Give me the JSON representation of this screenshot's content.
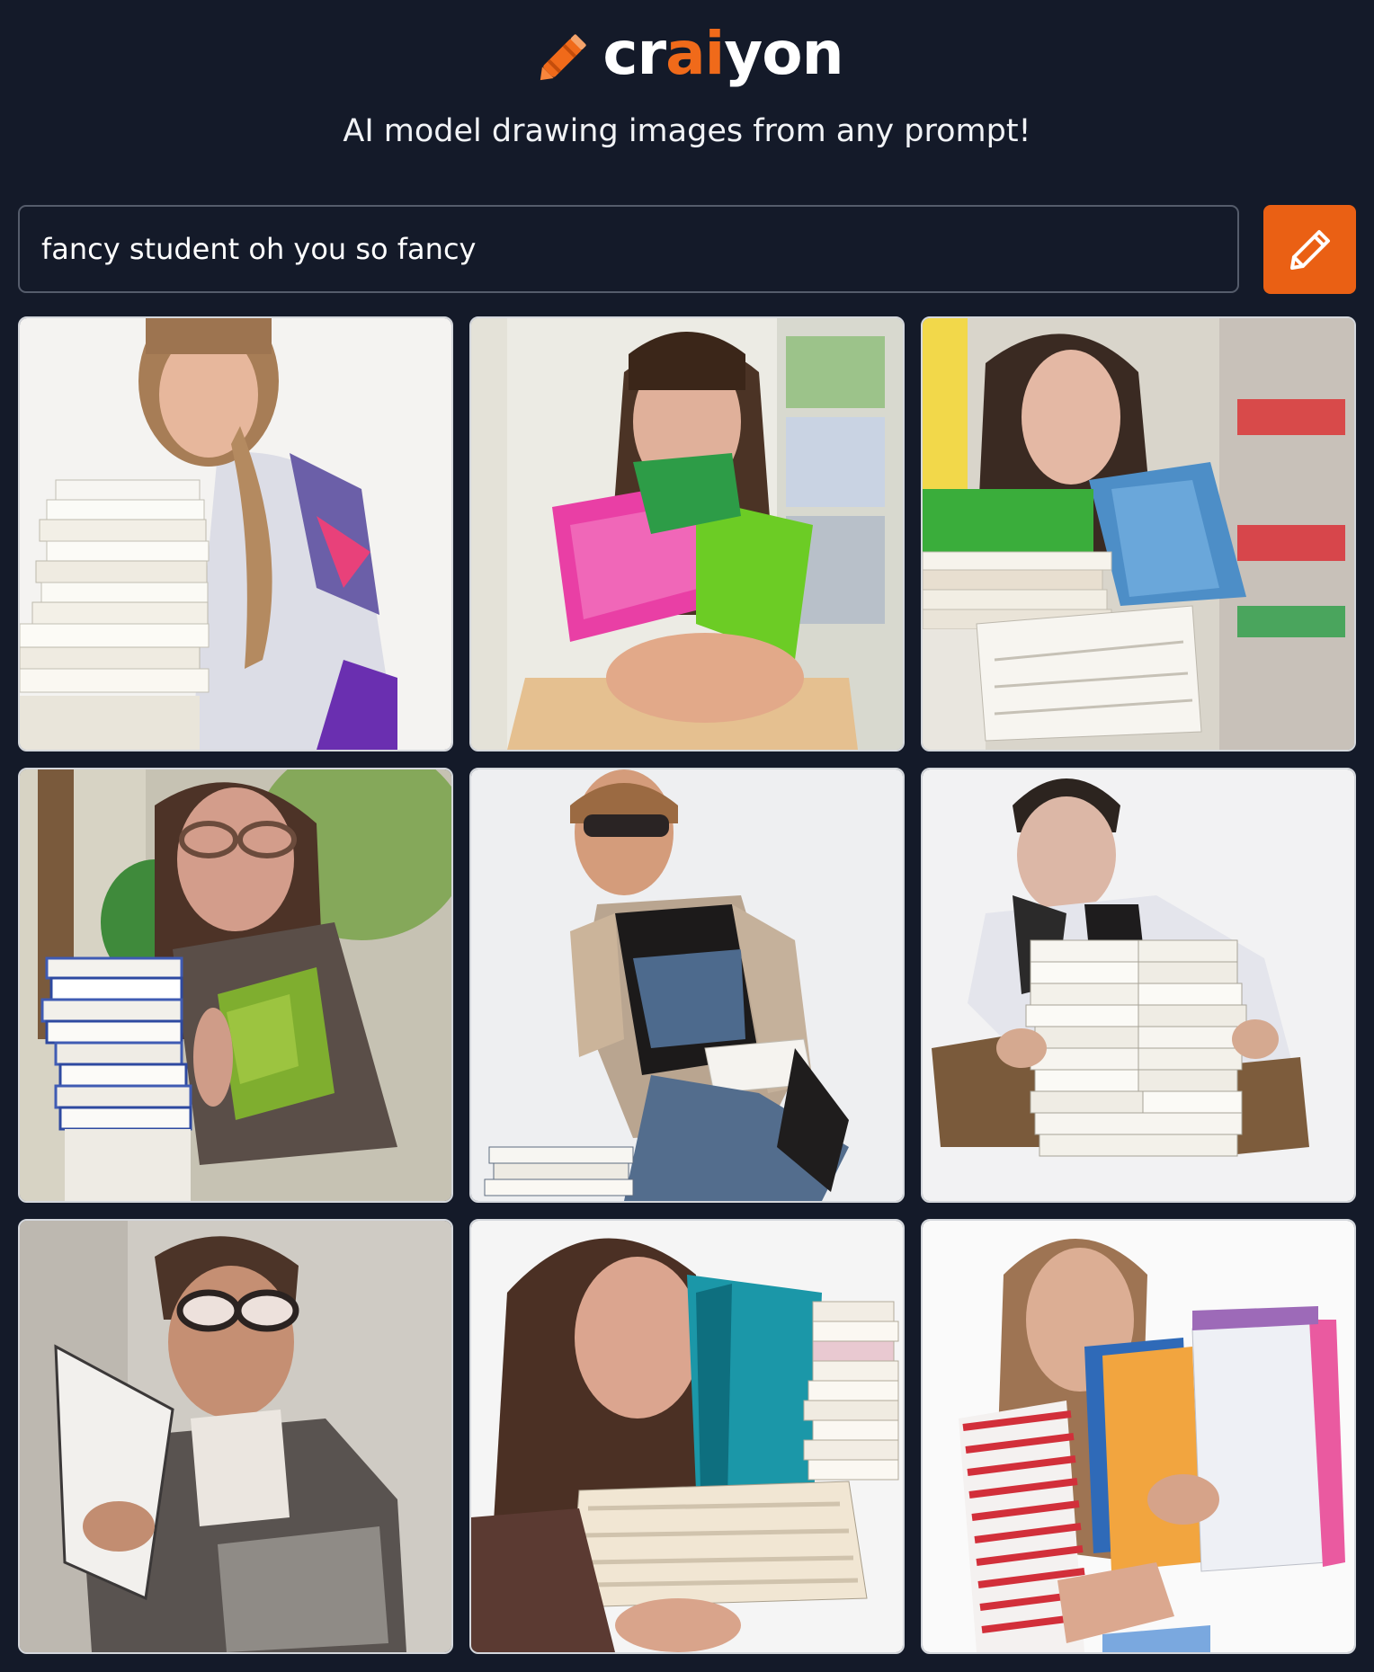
{
  "header": {
    "logo_text_pre": "cr",
    "logo_text_accent": "ai",
    "logo_text_post": "yon",
    "tagline": "AI model drawing images from any prompt!"
  },
  "colors": {
    "background": "#141a29",
    "accent": "#ea6014",
    "input_border": "#555c6b",
    "tile_border": "#d4d7dc"
  },
  "search": {
    "value": "fancy student oh you so fancy",
    "button_icon": "pencil-icon"
  },
  "results": {
    "count": 9
  }
}
